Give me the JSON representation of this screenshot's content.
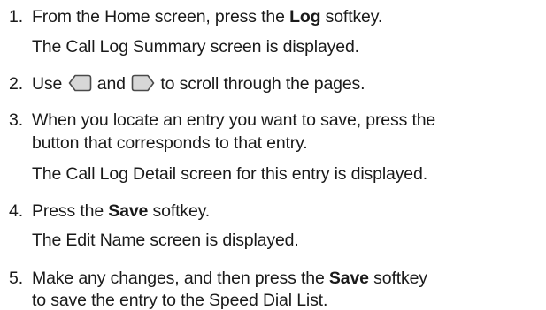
{
  "steps": [
    {
      "number": "1.",
      "pre": "From the Home screen, press the ",
      "bold": "Log",
      "post": " softkey.",
      "result": "The Call Log Summary screen is displayed."
    },
    {
      "number": "2.",
      "pre": "Use ",
      "mid": " and ",
      "post": " to scroll through the pages.",
      "left_key_icon": "left-arrow-key",
      "right_key_icon": "right-arrow-key"
    },
    {
      "number": "3.",
      "line1": "When you locate an entry you want to save, press the",
      "line2": "button that corresponds to that entry.",
      "result": "The Call Log Detail screen for this entry is displayed."
    },
    {
      "number": "4.",
      "pre": "Press the ",
      "bold": "Save",
      "post": " softkey.",
      "result": "The Edit Name screen is displayed."
    },
    {
      "number": "5.",
      "pre": "Make any changes, and then press the ",
      "bold": "Save",
      "post": " softkey",
      "line2": "to save the entry to the Speed Dial List."
    }
  ]
}
